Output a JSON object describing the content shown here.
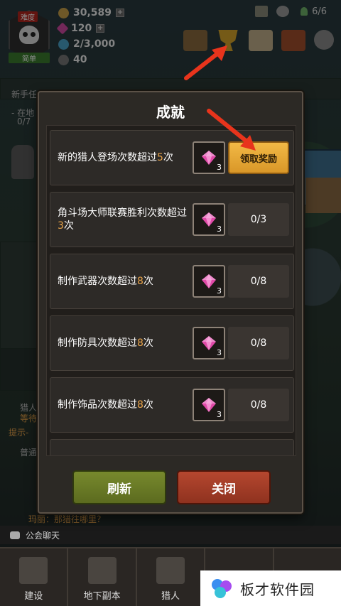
{
  "hud": {
    "difficulty_label": "难度",
    "difficulty_value": "简单",
    "gold": "30,589",
    "gems": "120",
    "essence": "2/3,000",
    "souls": "40",
    "hunters_count": "6/6"
  },
  "side": {
    "quest_title": "新手任",
    "quest_line": "- 在地",
    "quest_progress": "0/7",
    "hint_text": "提示-",
    "hunter_waiting": "猎人",
    "hunter_waiting2": "等待",
    "chat_tab": "普通",
    "chat_line": "玛丽：那猎往哪里？"
  },
  "chat_bar": {
    "label": "公会聊天"
  },
  "bottom_nav": [
    {
      "label": "建设"
    },
    {
      "label": "地下副本"
    },
    {
      "label": "猎人"
    },
    {
      "label": ""
    },
    {
      "label": ""
    }
  ],
  "watermark": {
    "text": "板才软件园"
  },
  "modal": {
    "title": "成就",
    "refresh_label": "刷新",
    "close_label": "关闭",
    "achievements": [
      {
        "desc_pre": "新的猎人登场次数超过",
        "desc_num": "5",
        "desc_post": "次",
        "reward_qty": "3",
        "claimable": true,
        "claim_label": "领取奖励",
        "progress": ""
      },
      {
        "desc_pre": "角斗场大师联赛胜利次数超过",
        "desc_num": "3",
        "desc_post": "次",
        "reward_qty": "3",
        "claimable": false,
        "claim_label": "",
        "progress": "0/3"
      },
      {
        "desc_pre": "制作武器次数超过",
        "desc_num": "8",
        "desc_post": "次",
        "reward_qty": "3",
        "claimable": false,
        "claim_label": "",
        "progress": "0/8"
      },
      {
        "desc_pre": "制作防具次数超过",
        "desc_num": "8",
        "desc_post": "次",
        "reward_qty": "3",
        "claimable": false,
        "claim_label": "",
        "progress": "0/8"
      },
      {
        "desc_pre": "制作饰品次数超过",
        "desc_num": "8",
        "desc_post": "次",
        "reward_qty": "3",
        "claimable": false,
        "claim_label": "",
        "progress": "0/8"
      }
    ]
  },
  "colors": {
    "highlight": "#e8a34a",
    "claim": "#f2b946",
    "refresh": "#77892d",
    "close": "#b5472f",
    "gem": "#e04aa8",
    "arrow": "#e8341c"
  }
}
